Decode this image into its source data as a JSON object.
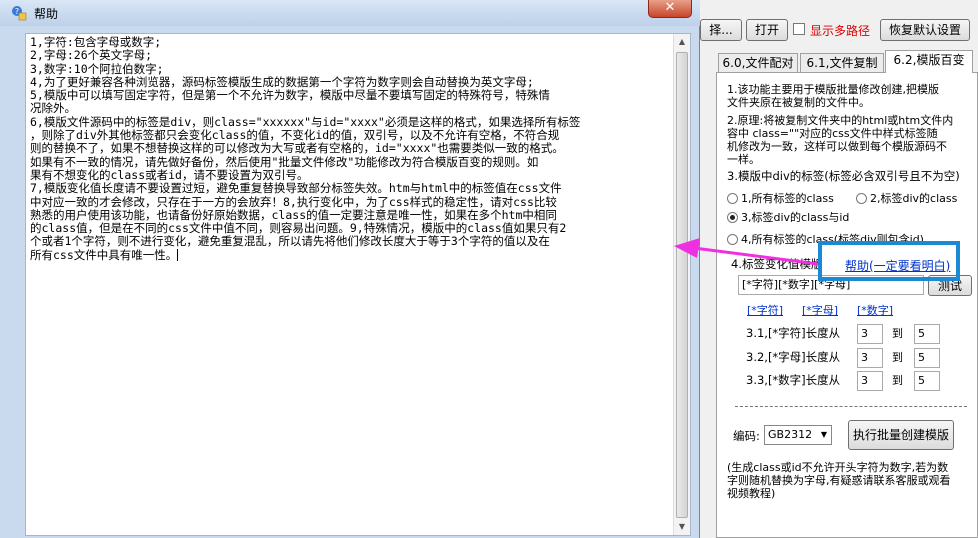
{
  "dialog": {
    "title": "帮助",
    "close_symbol": "✕",
    "lines": [
      "1,字符:包含字母或数字;",
      "2,字母:26个英文字母;",
      "3,数字:10个阿拉伯数字;",
      "4,为了更好兼容各种浏览器，源码标签模版生成的数据第一个字符为数字则会自动替换为英文字母;",
      "5,模版中可以填写固定字符，但是第一个不允许为数字，模版中尽量不要填写固定的特殊符号，特殊情",
      "况除外。",
      "6,模版文件源码中的标签是div，则class=\"xxxxxx\"与id=\"xxxx\"必须是这样的格式，如果选择所有标签",
      "，则除了div外其他标签都只会变化class的值，不变化id的值，双引号，以及不允许有空格，不符合规",
      "则的替换不了，如果不想替换这样的可以修改为大写或者有空格的，id=\"xxxx\"也需要类似一致的格式。",
      "如果有不一致的情况，请先做好备份，然后使用\"批量文件修改\"功能修改为符合模版百变的规则。如",
      "果有不想变化的class或者id，请不要设置为双引号。",
      "7,模版变化值长度请不要设置过短，避免重复替换导致部分标签失效。htm与html中的标签值在css文件",
      "中对应一致的才会修改，只存在于一方的会放弃！8,执行变化中，为了css样式的稳定性，请对css比较",
      "熟悉的用户使用该功能，也请备份好原始数据，class的值一定要注意是唯一性，如果在多个htm中相同",
      "的class值，但是在不同的css文件中值不同，则容易出问题。9,特殊情况，模版中的class值如果只有2",
      "个或者1个字符，则不进行变化，避免重复混乱，所以请先将他们修改长度大于等于3个字符的值以及在",
      "所有css文件中具有唯一性。"
    ]
  },
  "toolbar": {
    "select_label": "择...",
    "open_label": "打开",
    "multi_path_label": "显示多路径",
    "restore_label": "恢复默认设置"
  },
  "tabs": [
    "6.0,文件配对",
    "6.1,文件复制",
    "6.2,模版百变"
  ],
  "panel": {
    "desc1": [
      "1.该功能主要用于模版批量修改创建,把模版",
      "文件夹原在被复制的文件中。"
    ],
    "desc2": [
      "2.原理:将被复制文件夹中的html或htm文件内",
      "容中  class=\"\"对应的css文件中样式标签随",
      "机修改为一致，这样可以做到每个模版源码不",
      "一样。"
    ],
    "div_rule": "3.模版中div的标签(标签必含双引号且不为空)",
    "opt1": "1,所有标签的class",
    "opt2": "2,标签div的class",
    "opt3": "3,标签div的class与id",
    "opt4": "4,所有标签的class(标签div则包含id)",
    "change_value": "4.标签变化值模版",
    "help_link": "帮助(一定要看明白)",
    "template_value": "[*字符][*数字][*字母]",
    "test_button": "测试",
    "link_char": "[*字符]",
    "link_letter": "[*字母]",
    "link_digit": "[*数字]",
    "len1": "3.1,[*字符]长度从",
    "len2": "3.2,[*字母]长度从",
    "len3": "3.3,[*数字]长度从",
    "to": "到",
    "from_val": "3",
    "to_val": "5",
    "encoding_label": "编码:",
    "encoding_value": "GB2312",
    "run_button": "执行批量创建模版",
    "note": [
      "(生成class或id不允许开头字符为数字,若为数",
      "字则随机替换为字母,有疑惑请联系客服或观看",
      "视频教程)"
    ]
  }
}
